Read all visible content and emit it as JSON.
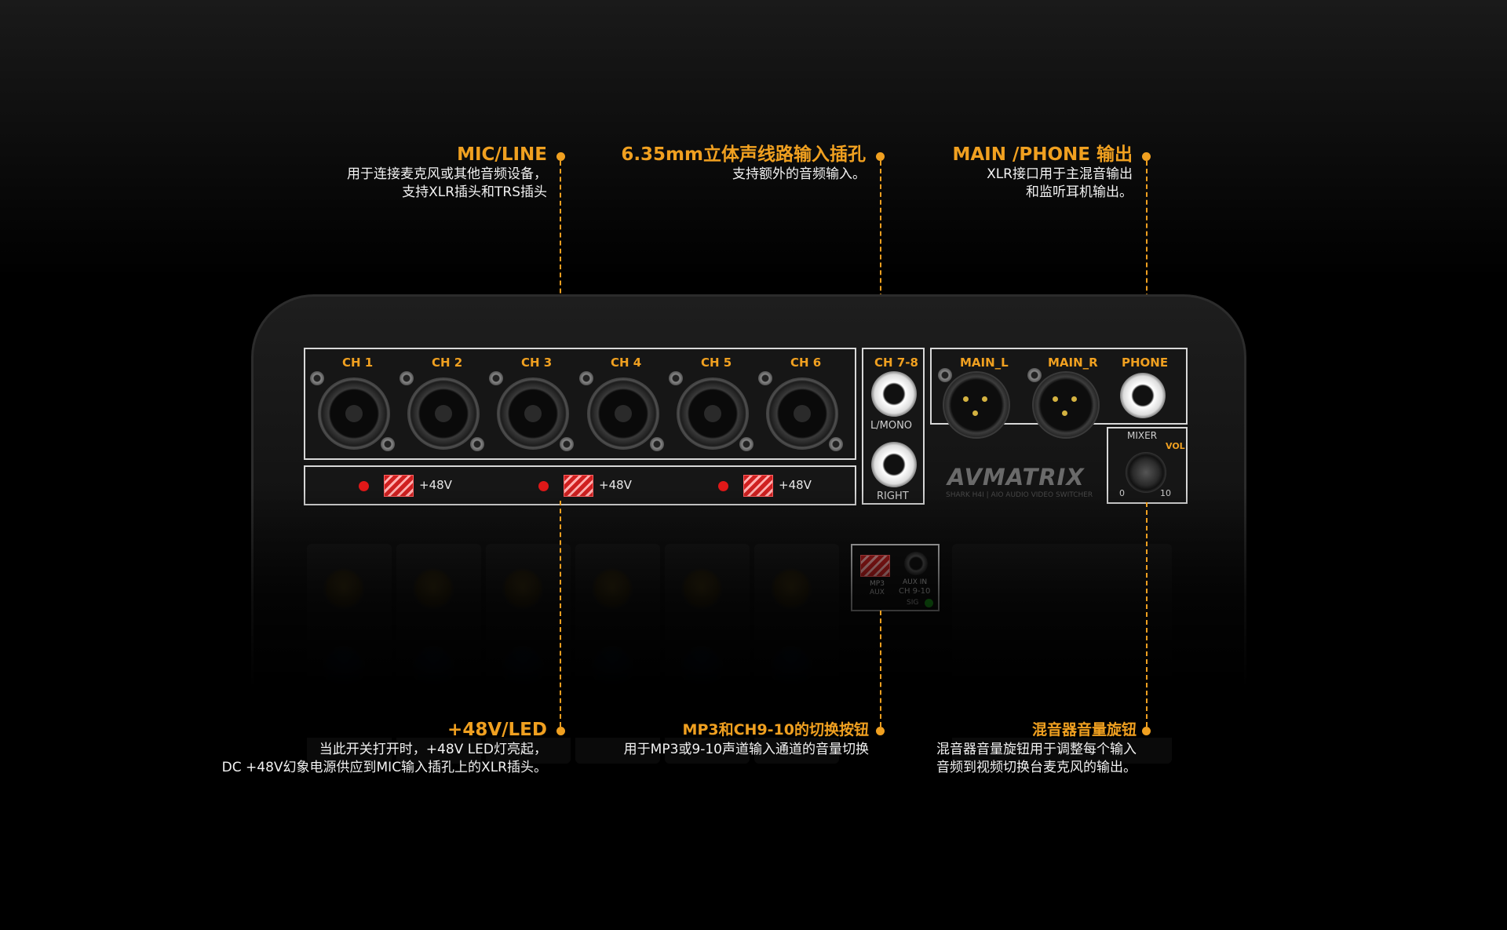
{
  "callouts": {
    "mic_line": {
      "title": "MIC/LINE",
      "desc1": "用于连接麦克风或其他音频设备，",
      "desc2": "支持XLR插头和TRS插头"
    },
    "stereo_in": {
      "title": "6.35mm立体声线路输入插孔",
      "desc1": "支持额外的音频输入。"
    },
    "main_phone": {
      "title": "MAIN /PHONE 输出",
      "desc1": "XLR接口用于主混音输出",
      "desc2": "和监听耳机输出。"
    },
    "phantom": {
      "title": "+48V/LED",
      "desc1": "当此开关打开时，+48V LED灯亮起，",
      "desc2": "DC +48V幻象电源供应到MIC输入插孔上的XLR插头。"
    },
    "mp3_switch": {
      "title": "MP3和CH9-10的切换按钮",
      "desc1": "用于MP3或9-10声道输入通道的音量切换"
    },
    "mixer_vol": {
      "title": "混音器音量旋钮",
      "desc1": "混音器音量旋钮用于调整每个输入",
      "desc2": "音频到视频切换台麦克风的输出。"
    }
  },
  "device": {
    "channels": [
      "CH 1",
      "CH 2",
      "CH 3",
      "CH 4",
      "CH 5",
      "CH 6"
    ],
    "phantom_label": "+48V",
    "stereo": {
      "title": "CH 7-8",
      "left": "L/MONO",
      "right": "RIGHT"
    },
    "outputs": {
      "main_l": "MAIN_L",
      "main_r": "MAIN_R",
      "phone": "PHONE"
    },
    "mixer": {
      "title": "MIXER",
      "vol": "VOL",
      "min": "0",
      "max": "10"
    },
    "brand": {
      "logo": "AVMATRIX",
      "model": "SHARK H4I | AIO AUDIO VIDEO SWITCHER"
    },
    "aux": {
      "mp3": "MP3",
      "aux": "AUX",
      "aux_in": "AUX IN",
      "ch": "CH 9-10",
      "sig": "SIG"
    }
  },
  "colors": {
    "accent": "#f0a020",
    "led": "#e01818",
    "switch": "#d02020",
    "sig_led": "#20c020"
  }
}
